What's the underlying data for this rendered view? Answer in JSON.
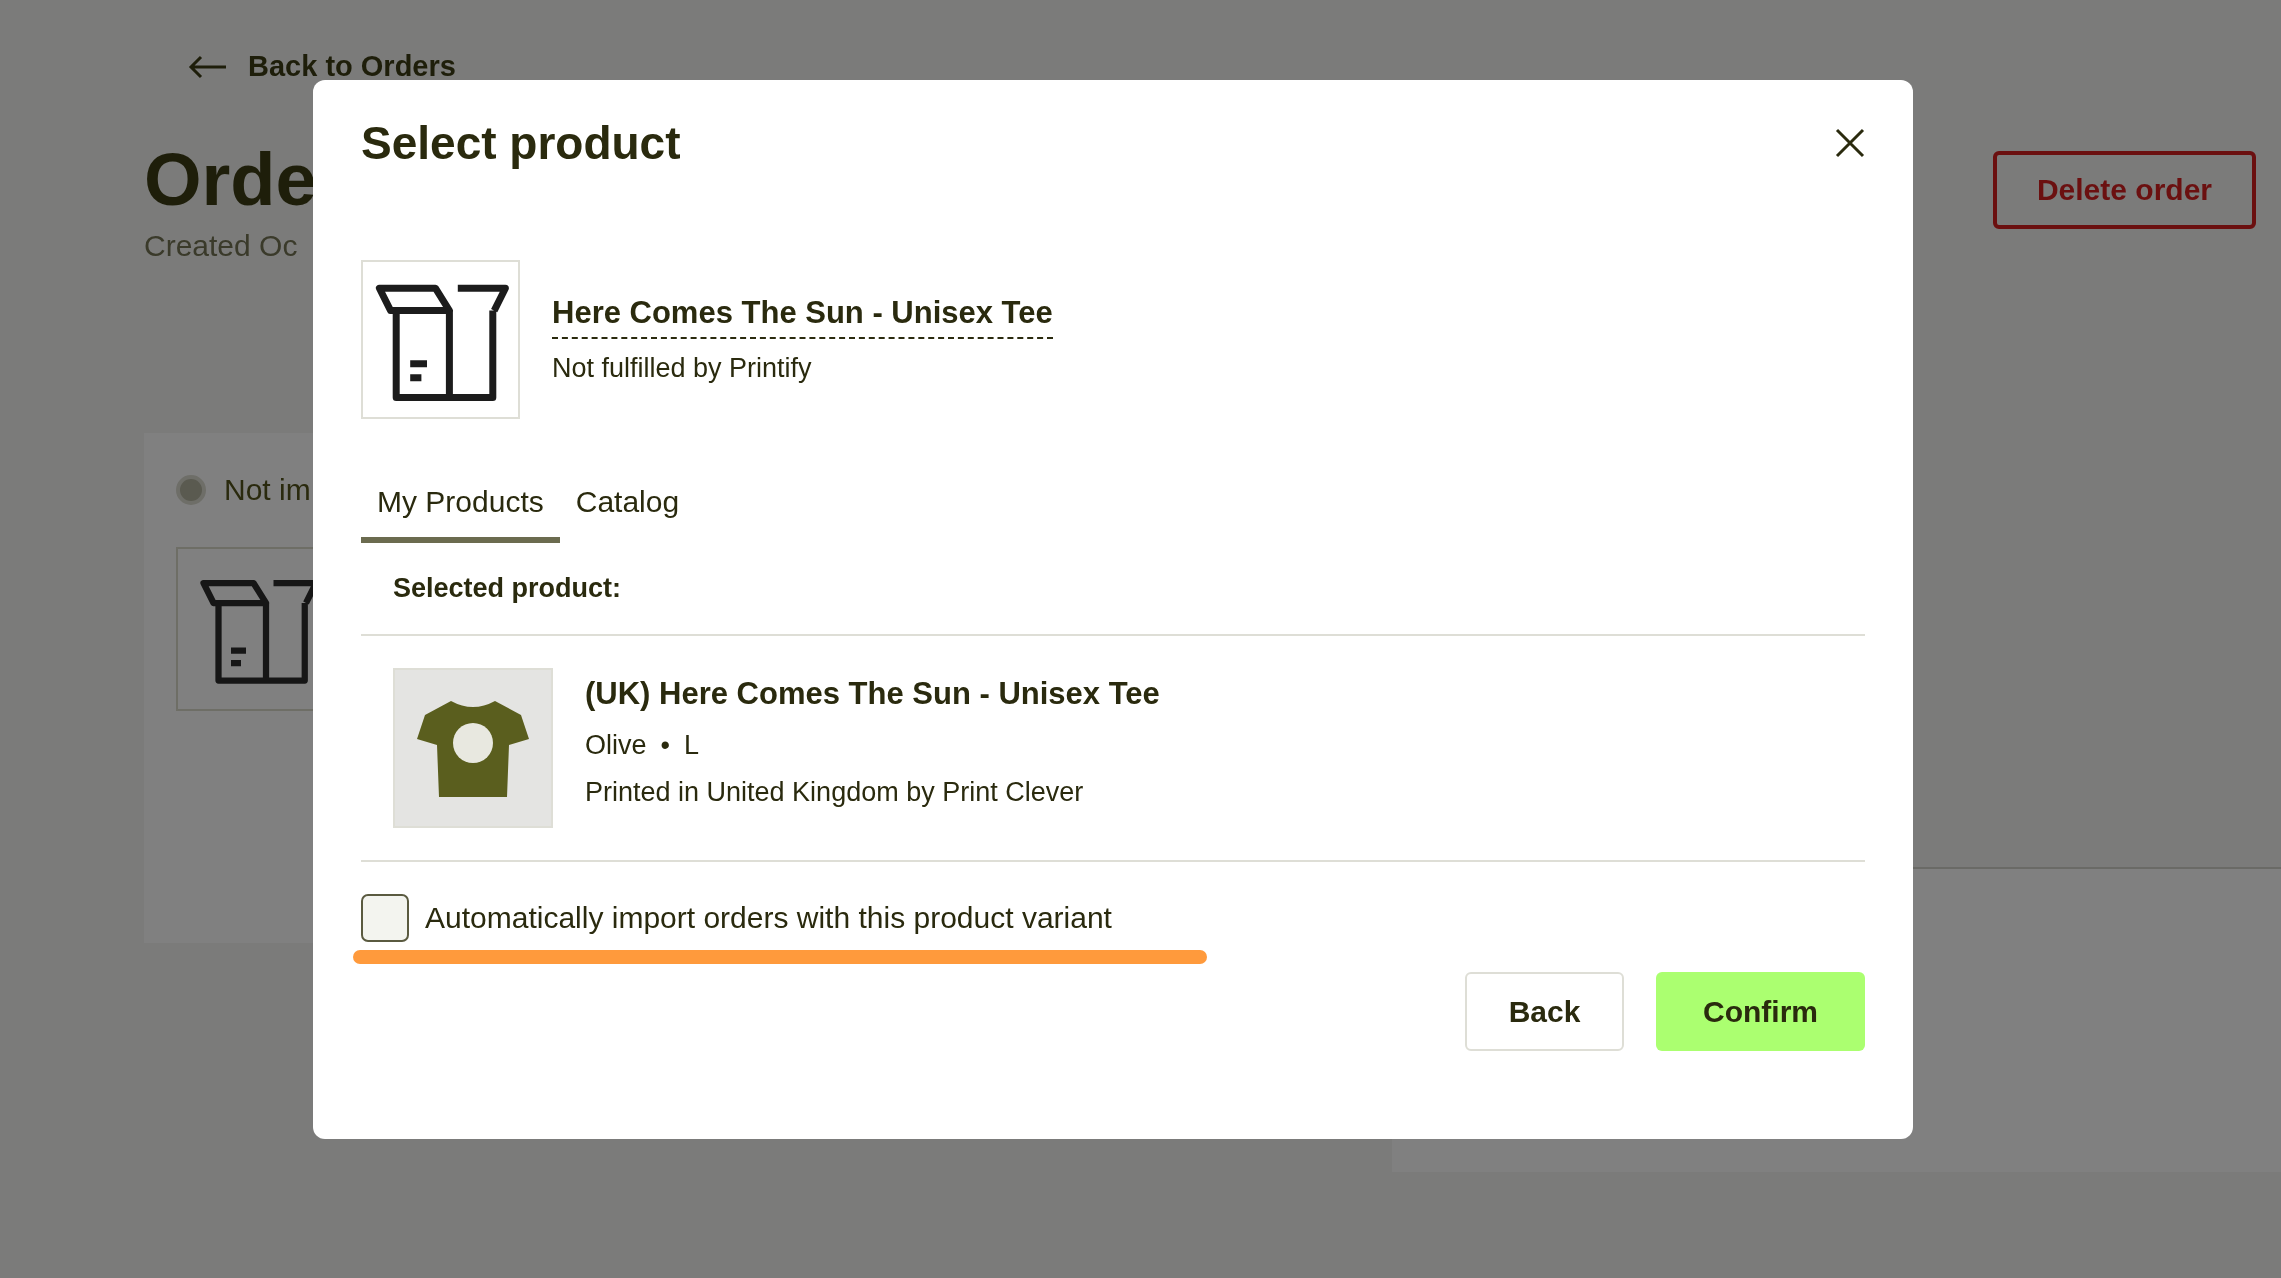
{
  "background_page": {
    "back_link": "Back to Orders",
    "title": "Orde",
    "subtitle": "Created Oc",
    "delete_button": "Delete order",
    "status_label": "Not im"
  },
  "modal": {
    "title": "Select product",
    "product": {
      "name": "Here Comes The Sun - Unisex Tee",
      "note": "Not fulfilled by Printify"
    },
    "tabs": [
      {
        "label": "My Products",
        "selected": true
      },
      {
        "label": "Catalog",
        "selected": false
      }
    ],
    "selected_label": "Selected product:",
    "variant": {
      "name": "(UK) Here Comes The Sun - Unisex Tee",
      "options": [
        "Olive",
        "L"
      ],
      "separator": "•",
      "printed": "Printed in United Kingdom by Print Clever"
    },
    "auto_import": {
      "label": "Automatically import orders with this product variant",
      "checked": false
    },
    "buttons": {
      "back": "Back",
      "confirm": "Confirm"
    }
  }
}
